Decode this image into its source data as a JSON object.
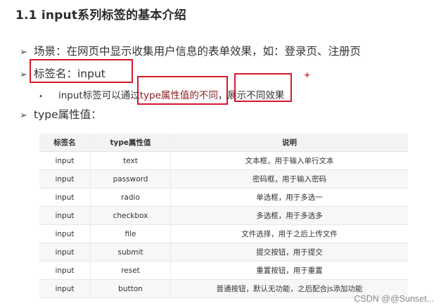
{
  "title": "1.1 input系列标签的基本介绍",
  "bullets": {
    "arrow": "➢",
    "scene": "场景：在网页中显示收集用户信息的表单效果，如：登录页、注册页",
    "tag_name": "标签名：input",
    "sub_dot": "•",
    "sub_pre": "input标签可以通过",
    "sub_red": "type属性值的不同",
    "sub_post": "，展示不同效果",
    "type_attr": "type属性值："
  },
  "plus_mark": "+",
  "table": {
    "headers": [
      "标签名",
      "type属性值",
      "说明"
    ],
    "rows": [
      [
        "input",
        "text",
        "文本框，用于输入单行文本"
      ],
      [
        "input",
        "password",
        "密码框，用于输入密码"
      ],
      [
        "input",
        "radio",
        "单选框，用于多选一"
      ],
      [
        "input",
        "checkbox",
        "多选框，用于多选多"
      ],
      [
        "input",
        "file",
        "文件选择，用于之后上传文件"
      ],
      [
        "input",
        "submit",
        "提交按钮，用于提交"
      ],
      [
        "input",
        "reset",
        "重置按钮，用于重置"
      ],
      [
        "input",
        "button",
        "普通按钮，默认无功能，之后配合js添加功能"
      ]
    ]
  },
  "watermark": "CSDN @@Sunset..."
}
